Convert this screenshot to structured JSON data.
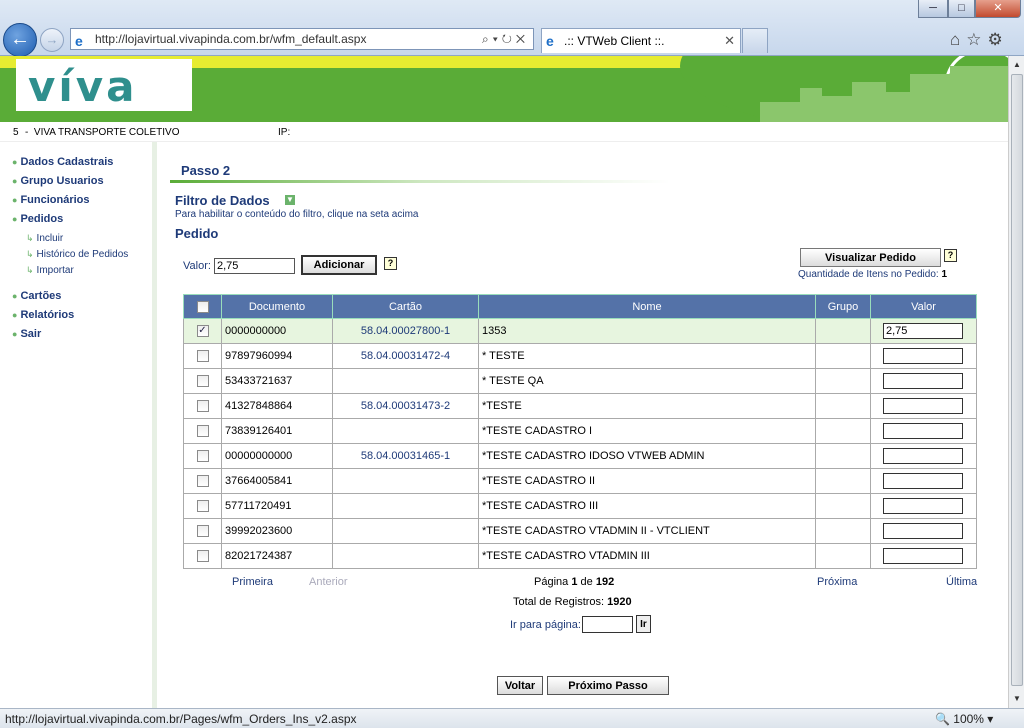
{
  "browser": {
    "url": "http://lojavirtual.vivapinda.com.br/wfm_default.aspx",
    "tab_title": ".:: VTWeb Client ::.",
    "window_buttons": [
      "─",
      "□",
      "✕"
    ],
    "status_url": "http://lojavirtual.vivapinda.com.br/Pages/wfm_Orders_Ins_v2.aspx",
    "zoom": "🔍 100% ▾"
  },
  "header": {
    "logo": "víva",
    "company_code": "5",
    "separator": "-",
    "company_name": "VIVA TRANSPORTE COLETIVO",
    "ip_label": "IP:"
  },
  "sidebar": {
    "items": [
      {
        "label": "Dados Cadastrais"
      },
      {
        "label": "Grupo Usuarios"
      },
      {
        "label": "Funcionários"
      },
      {
        "label": "Pedidos"
      },
      {
        "label": "Cartões"
      },
      {
        "label": "Relatórios"
      },
      {
        "label": "Sair"
      }
    ],
    "sub_items": [
      {
        "label": "Incluir"
      },
      {
        "label": "Histórico de Pedidos"
      },
      {
        "label": "Importar"
      }
    ]
  },
  "main": {
    "step_title": "Passo 2",
    "filter_title": "Filtro de Dados",
    "filter_hint": "Para habilitar o conteúdo do filtro, clique na seta acima",
    "order_title": "Pedido",
    "valor_label": "Valor:",
    "valor_value": "2,75",
    "add_button": "Adicionar",
    "help": "?",
    "view_order_button": "Visualizar Pedido",
    "qty_label": "Quantidade de Itens no Pedido:",
    "qty_value": "1"
  },
  "table": {
    "headers": [
      "Documento",
      "Cartão",
      "Nome",
      "Grupo",
      "Valor"
    ],
    "rows": [
      {
        "checked": true,
        "documento": "0000000000",
        "cartao": "58.04.00027800-1",
        "nome": "1353",
        "grupo": "",
        "valor": "2,75"
      },
      {
        "checked": false,
        "documento": "97897960994",
        "cartao": "58.04.00031472-4",
        "nome": "* TESTE",
        "grupo": "",
        "valor": ""
      },
      {
        "checked": false,
        "documento": "53433721637",
        "cartao": "",
        "nome": "* TESTE QA",
        "grupo": "",
        "valor": ""
      },
      {
        "checked": false,
        "documento": "41327848864",
        "cartao": "58.04.00031473-2",
        "nome": "*TESTE",
        "grupo": "",
        "valor": ""
      },
      {
        "checked": false,
        "documento": "73839126401",
        "cartao": "",
        "nome": "*TESTE CADASTRO I",
        "grupo": "",
        "valor": ""
      },
      {
        "checked": false,
        "documento": "00000000000",
        "cartao": "58.04.00031465-1",
        "nome": "*TESTE CADASTRO IDOSO VTWEB ADMIN",
        "grupo": "",
        "valor": ""
      },
      {
        "checked": false,
        "documento": "37664005841",
        "cartao": "",
        "nome": "*TESTE CADASTRO II",
        "grupo": "",
        "valor": ""
      },
      {
        "checked": false,
        "documento": "57711720491",
        "cartao": "",
        "nome": "*TESTE CADASTRO III",
        "grupo": "",
        "valor": ""
      },
      {
        "checked": false,
        "documento": "39992023600",
        "cartao": "",
        "nome": "*TESTE CADASTRO VTADMIN II - VTCLIENT",
        "grupo": "",
        "valor": ""
      },
      {
        "checked": false,
        "documento": "82021724387",
        "cartao": "",
        "nome": "*TESTE CADASTRO VTADMIN III",
        "grupo": "",
        "valor": ""
      }
    ]
  },
  "pager": {
    "first": "Primeira",
    "prev": "Anterior",
    "page_label": "Página",
    "page_current": "1",
    "page_of": "de",
    "page_total": "192",
    "next": "Próxima",
    "last": "Última",
    "total_label": "Total de Registros:",
    "total_value": "1920",
    "goto_label": "Ir para página:",
    "goto_button": "Ir"
  },
  "footer_buttons": {
    "back": "Voltar",
    "next_step": "Próximo Passo"
  }
}
